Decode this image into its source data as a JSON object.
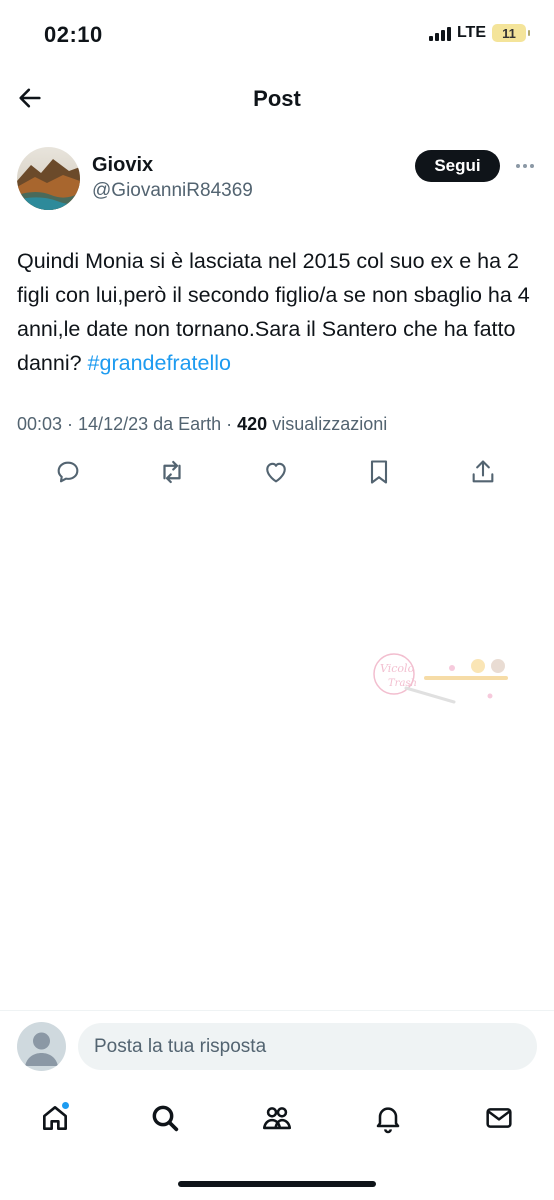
{
  "status_bar": {
    "time": "02:10",
    "network": "LTE",
    "battery": "11"
  },
  "header": {
    "title": "Post",
    "back_icon": "arrow-left-icon"
  },
  "author": {
    "name": "Giovix",
    "handle": "@GiovanniR84369",
    "follow_label": "Segui",
    "more_icon": "more-horizontal-icon"
  },
  "tweet": {
    "text": "Quindi Monia si è lasciata nel 2015 col suo ex e ha 2 figli con lui,però il secondo figlio/a se non sbaglio ha 4 anni,le date non tornano.Sara il Santero che ha fatto danni? ",
    "hashtag": "#grandefratello",
    "meta_prefix": "00:03 · 14/12/23 da Earth · ",
    "views_count": "420",
    "views_label": " visualizzazioni"
  },
  "actions": [
    {
      "name": "reply",
      "icon": "reply-icon"
    },
    {
      "name": "repost",
      "icon": "repost-icon"
    },
    {
      "name": "like",
      "icon": "heart-icon"
    },
    {
      "name": "bookmark",
      "icon": "bookmark-icon"
    },
    {
      "name": "share",
      "icon": "share-icon"
    }
  ],
  "reply_bar": {
    "placeholder": "Posta la tua risposta"
  },
  "bottom_nav": [
    {
      "name": "home",
      "icon": "home-icon",
      "has_notification": true
    },
    {
      "name": "search",
      "icon": "search-icon"
    },
    {
      "name": "communities",
      "icon": "communities-icon"
    },
    {
      "name": "notifications",
      "icon": "bell-icon"
    },
    {
      "name": "messages",
      "icon": "mail-icon"
    }
  ],
  "colors": {
    "accent": "#1d9bf0",
    "text": "#0f1419",
    "secondary": "#536471",
    "follow_bg": "#0f1419"
  }
}
